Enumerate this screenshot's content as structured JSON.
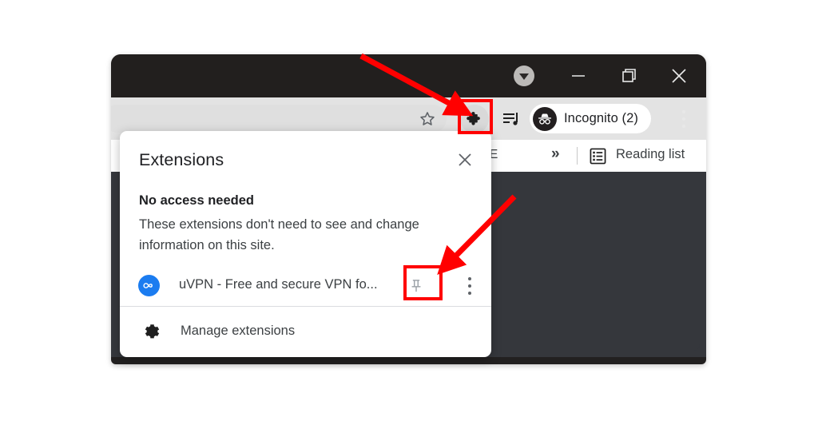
{
  "browser": {
    "titlebar": {
      "download_icon": "download-chevron-circle-icon",
      "minimize_label": "–",
      "maximize_label": "❐",
      "close_label": "✕"
    },
    "toolbar": {
      "bookmark_star_icon": "star-icon",
      "extensions_icon": "puzzle-piece-icon",
      "media_control_icon": "media-playlist-icon",
      "profile_label": "Incognito (2)",
      "profile_avatar_icon": "incognito-hat-glasses-icon",
      "menu_icon": "three-dot-menu-icon"
    },
    "bookmarks_bar": {
      "truncated_bookmark": "VE",
      "overflow_label": "»",
      "reading_list_icon": "reading-list-icon",
      "reading_list_label": "Reading list"
    }
  },
  "extensions_popup": {
    "title": "Extensions",
    "close_icon": "close-icon",
    "section": {
      "heading": "No access needed",
      "description": "These extensions don't need to see and change information on this site."
    },
    "items": [
      {
        "favicon_icon": "uvpn-infinity-icon",
        "name": "uVPN - Free and secure VPN fo...",
        "pin_icon": "pin-icon",
        "menu_icon": "three-dot-menu-icon"
      }
    ],
    "footer": {
      "gear_icon": "gear-icon",
      "label": "Manage extensions"
    }
  },
  "annotations": {
    "highlight_color": "#FF0000",
    "boxes": [
      {
        "name": "extensions-toolbar-button-highlight"
      },
      {
        "name": "pin-button-highlight"
      }
    ],
    "arrows": [
      {
        "name": "arrow-to-extensions-button"
      },
      {
        "name": "arrow-to-pin-button"
      }
    ]
  },
  "colors": {
    "titlebar": "#221F1E",
    "toolbar": "#E3E3E3",
    "page_content": "#35373C",
    "popup_bg": "#FFFFFF",
    "extension_favicon": "#1B7CF0",
    "annotation_red": "#FF0000"
  }
}
